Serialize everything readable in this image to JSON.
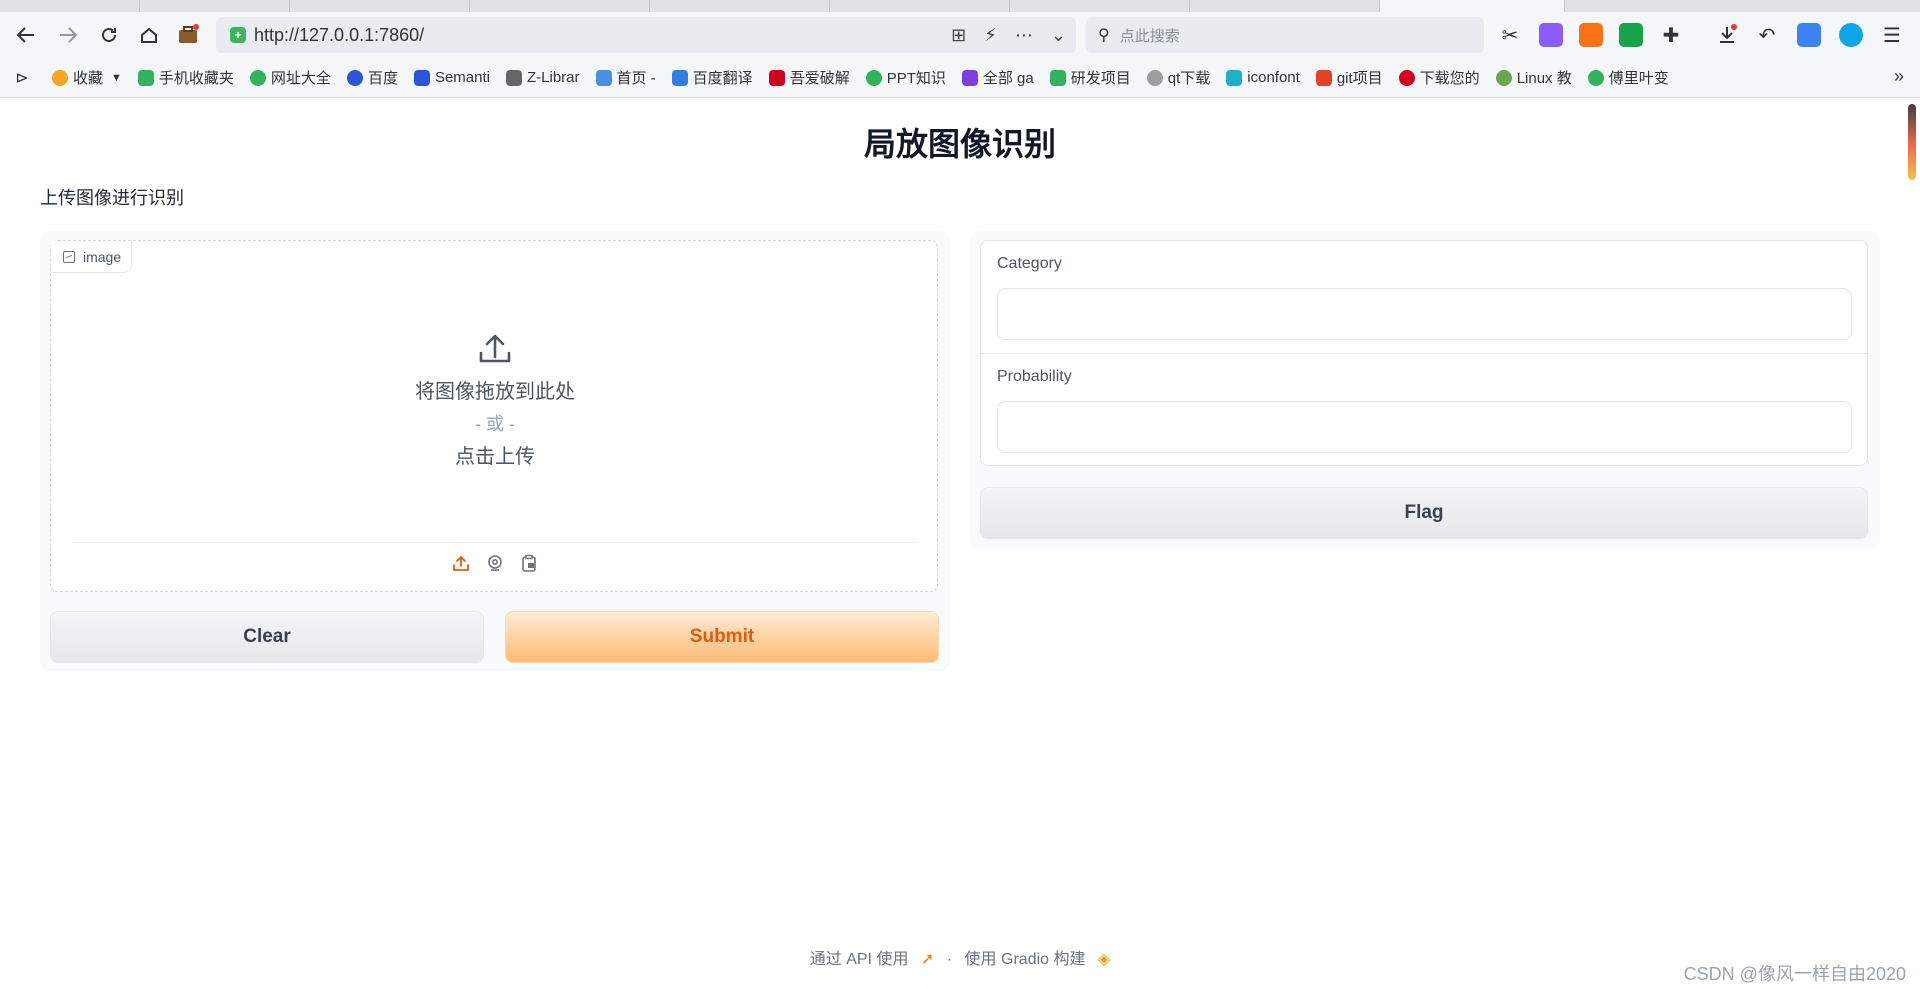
{
  "browser": {
    "url": "http://127.0.0.1:7860/",
    "search_placeholder": "点此搜索"
  },
  "bookmarks": [
    {
      "label": "收藏",
      "color": "#f5a623"
    },
    {
      "label": "手机收藏夹",
      "color": "#2fb35c"
    },
    {
      "label": "网址大全",
      "color": "#2fb35c"
    },
    {
      "label": "百度",
      "color": "#2c54d8"
    },
    {
      "label": "Semanti",
      "color": "#2c54d8"
    },
    {
      "label": "Z-Librar",
      "color": "#666666"
    },
    {
      "label": "首页 -",
      "color": "#4a90e2"
    },
    {
      "label": "百度翻译",
      "color": "#2f7de1"
    },
    {
      "label": "吾爱破解",
      "color": "#d0021b"
    },
    {
      "label": "PPT知识",
      "color": "#2fb35c"
    },
    {
      "label": "全部 ga",
      "color": "#7b3fe4"
    },
    {
      "label": "研发项目",
      "color": "#2fb35c"
    },
    {
      "label": "qt下载",
      "color": "#9e9e9e"
    },
    {
      "label": "iconfont",
      "color": "#1fb0c9"
    },
    {
      "label": "git项目",
      "color": "#e24329"
    },
    {
      "label": "下载您的",
      "color": "#d0021b"
    },
    {
      "label": "Linux 教",
      "color": "#6aa84f"
    },
    {
      "label": "傅里叶变",
      "color": "#2fb35c"
    }
  ],
  "app": {
    "title": "局放图像识别",
    "description": "上传图像进行识别",
    "image_label": "image",
    "upload_drop_text": "将图像拖放到此处",
    "upload_or_text": "- 或 -",
    "upload_click_text": "点击上传",
    "clear_label": "Clear",
    "submit_label": "Submit",
    "category_label": "Category",
    "category_value": "",
    "probability_label": "Probability",
    "probability_value": "",
    "flag_label": "Flag"
  },
  "footer": {
    "api_text": "通过 API 使用",
    "separator": "·",
    "built_text": "使用 Gradio 构建"
  },
  "watermark": "CSDN @像风一样自由2020",
  "colors": {
    "accent": "#ea580c",
    "submit_bg": "#fdba74"
  }
}
